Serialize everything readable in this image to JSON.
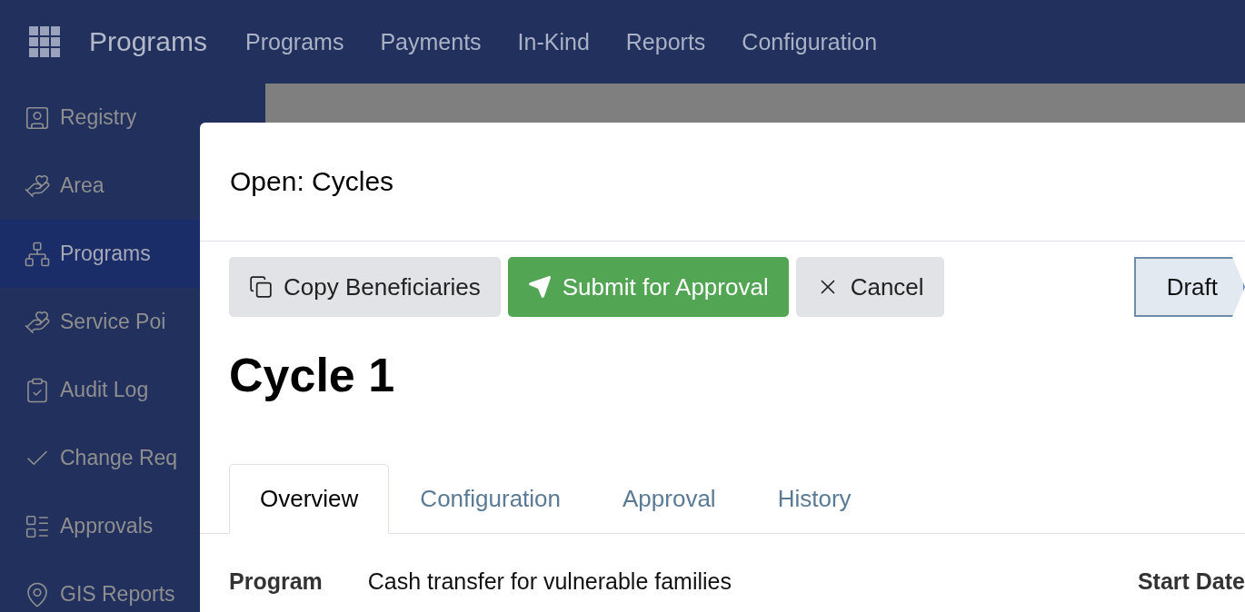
{
  "navbar": {
    "brand": "Programs",
    "menu": [
      "Programs",
      "Payments",
      "In-Kind",
      "Reports",
      "Configuration"
    ]
  },
  "sidebar": {
    "items": [
      {
        "label": "Registry",
        "selected": false
      },
      {
        "label": "Area",
        "selected": false
      },
      {
        "label": "Programs",
        "selected": true
      },
      {
        "label": "Service Poi",
        "selected": false
      },
      {
        "label": "Audit Log",
        "selected": false
      },
      {
        "label": "Change Req",
        "selected": false
      },
      {
        "label": "Approvals",
        "selected": false
      },
      {
        "label": "GIS Reports",
        "selected": false
      }
    ]
  },
  "dialog": {
    "title": "Open: Cycles",
    "buttons": [
      {
        "label": "Copy Beneficiaries",
        "kind": "secondary"
      },
      {
        "label": "Submit for Approval",
        "kind": "primary"
      },
      {
        "label": "Cancel",
        "kind": "secondary"
      }
    ],
    "status_stages": [
      {
        "label": "Draft",
        "selected": true
      }
    ],
    "record_title": "Cycle 1",
    "tabs": [
      {
        "label": "Overview",
        "selected": true
      },
      {
        "label": "Configuration",
        "selected": false
      },
      {
        "label": "Approval",
        "selected": false
      },
      {
        "label": "History",
        "selected": false
      }
    ],
    "fields": [
      {
        "label": "Program",
        "value": "Cash transfer for vulnerable families"
      },
      {
        "label": "Start Date"
      }
    ]
  }
}
